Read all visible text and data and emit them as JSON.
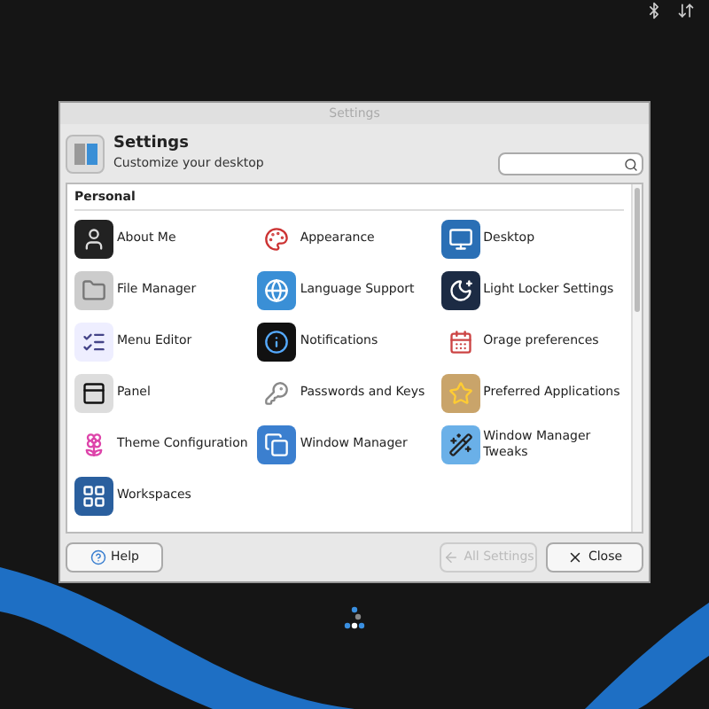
{
  "window": {
    "title": "Settings"
  },
  "header": {
    "title": "Settings",
    "subtitle": "Customize your desktop"
  },
  "sections": [
    {
      "title": "Personal",
      "items": [
        {
          "label": "About Me"
        },
        {
          "label": "Appearance"
        },
        {
          "label": "Desktop"
        },
        {
          "label": "File Manager"
        },
        {
          "label": "Language Support"
        },
        {
          "label": "Light Locker Settings"
        },
        {
          "label": "Menu Editor"
        },
        {
          "label": "Notifications"
        },
        {
          "label": "Orage preferences"
        },
        {
          "label": "Panel"
        },
        {
          "label": "Passwords and Keys"
        },
        {
          "label": "Preferred Applications"
        },
        {
          "label": "Theme Configuration"
        },
        {
          "label": "Window Manager"
        },
        {
          "label": "Window Manager Tweaks"
        },
        {
          "label": "Workspaces"
        }
      ]
    }
  ],
  "buttons": [
    {
      "kind": "help",
      "label": "Help",
      "disabled": false
    },
    {
      "kind": "back",
      "label": "All Settings",
      "disabled": true
    },
    {
      "kind": "close",
      "label": "Close",
      "disabled": false
    }
  ]
}
